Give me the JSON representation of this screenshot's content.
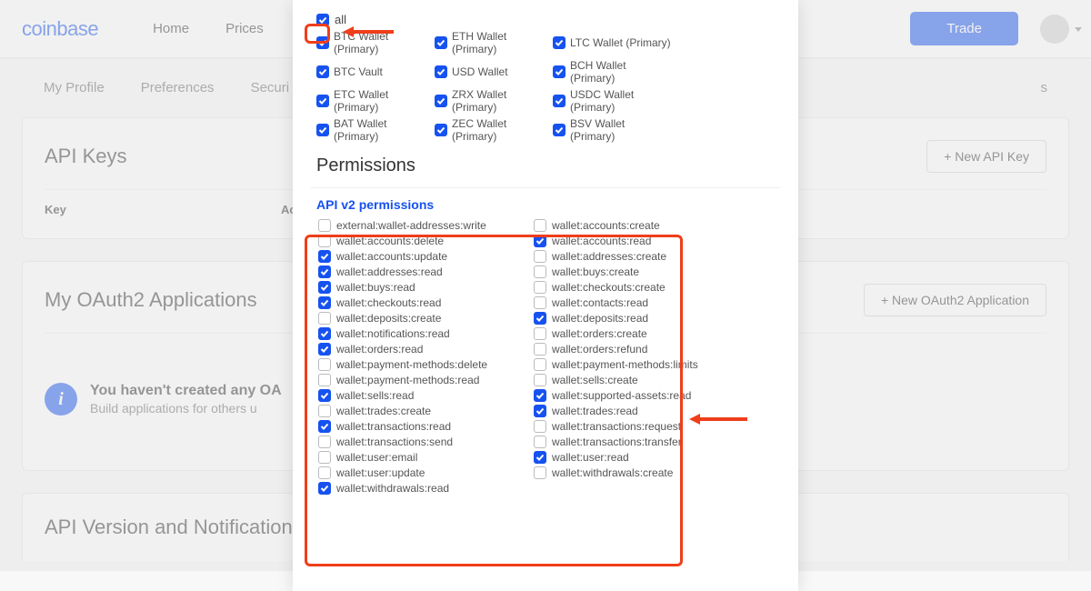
{
  "header": {
    "logo": "coinbase",
    "nav": [
      "Home",
      "Prices"
    ],
    "trade": "Trade"
  },
  "tabs": [
    "My Profile",
    "Preferences",
    "Securi"
  ],
  "tab_trail": "s",
  "api_keys": {
    "title": "API Keys",
    "button": "+  New API Key",
    "col_key": "Key",
    "col_act": "Ac"
  },
  "oauth": {
    "title": "My OAuth2 Applications",
    "button": "+  New OAuth2 Application",
    "info_title": "You haven't created any OA",
    "info_sub": "Build applications for others u"
  },
  "api_ver": {
    "title": "API Version and Notifications"
  },
  "modal": {
    "all_label": "all",
    "wallets_row1": [
      "BTC Wallet (Primary)",
      "ETH Wallet (Primary)",
      "LTC Wallet (Primary)",
      "BTC Vault"
    ],
    "wallets_row2": [
      "USD Wallet",
      "BCH Wallet (Primary)",
      "ETC Wallet (Primary)",
      "ZRX Wallet (Primary)"
    ],
    "wallets_row3": [
      "USDC Wallet (Primary)",
      "BAT Wallet (Primary)",
      "ZEC Wallet (Primary)",
      "BSV Wallet (Primary)"
    ],
    "perm_heading": "Permissions",
    "api_v2": "API v2 permissions",
    "perms": [
      {
        "l": "external:wallet-addresses:write",
        "lc": false,
        "r": "wallet:accounts:create",
        "rc": false
      },
      {
        "l": "wallet:accounts:delete",
        "lc": false,
        "r": "wallet:accounts:read",
        "rc": true
      },
      {
        "l": "wallet:accounts:update",
        "lc": true,
        "r": "wallet:addresses:create",
        "rc": false
      },
      {
        "l": "wallet:addresses:read",
        "lc": true,
        "r": "wallet:buys:create",
        "rc": false
      },
      {
        "l": "wallet:buys:read",
        "lc": true,
        "r": "wallet:checkouts:create",
        "rc": false
      },
      {
        "l": "wallet:checkouts:read",
        "lc": true,
        "r": "wallet:contacts:read",
        "rc": false
      },
      {
        "l": "wallet:deposits:create",
        "lc": false,
        "r": "wallet:deposits:read",
        "rc": true
      },
      {
        "l": "wallet:notifications:read",
        "lc": true,
        "r": "wallet:orders:create",
        "rc": false
      },
      {
        "l": "wallet:orders:read",
        "lc": true,
        "r": "wallet:orders:refund",
        "rc": false
      },
      {
        "l": "wallet:payment-methods:delete",
        "lc": false,
        "r": "wallet:payment-methods:limits",
        "rc": false
      },
      {
        "l": "wallet:payment-methods:read",
        "lc": false,
        "r": "wallet:sells:create",
        "rc": false
      },
      {
        "l": "wallet:sells:read",
        "lc": true,
        "r": "wallet:supported-assets:read",
        "rc": true
      },
      {
        "l": "wallet:trades:create",
        "lc": false,
        "r": "wallet:trades:read",
        "rc": true
      },
      {
        "l": "wallet:transactions:read",
        "lc": true,
        "r": "wallet:transactions:request",
        "rc": false
      },
      {
        "l": "wallet:transactions:send",
        "lc": false,
        "r": "wallet:transactions:transfer",
        "rc": false
      },
      {
        "l": "wallet:user:email",
        "lc": false,
        "r": "wallet:user:read",
        "rc": true
      },
      {
        "l": "wallet:user:update",
        "lc": false,
        "r": "wallet:withdrawals:create",
        "rc": false
      },
      {
        "l": "wallet:withdrawals:read",
        "lc": true,
        "r": "",
        "rc": false
      }
    ]
  }
}
